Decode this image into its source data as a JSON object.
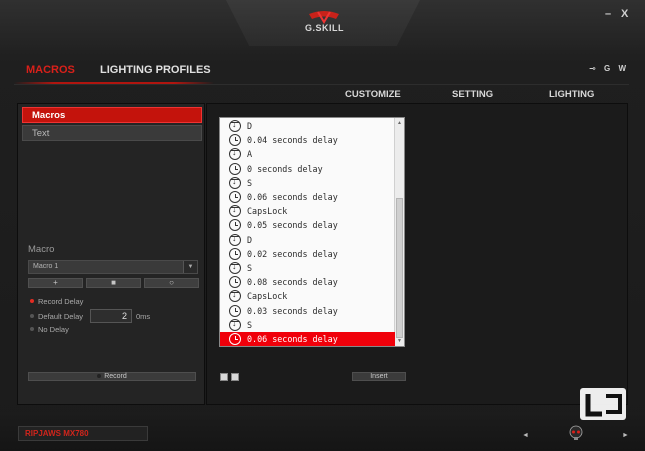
{
  "window": {
    "brand_text": "G.SKILL",
    "minimize_label": "–",
    "close_label": "X"
  },
  "nav": {
    "macros_label": "MACROS",
    "lighting_profiles_label": "LIGHTING PROFILES",
    "mini_icons": "⊸ G W"
  },
  "subtabs": [
    "CUSTOMIZE",
    "SETTING",
    "LIGHTING"
  ],
  "left": {
    "tabs": [
      {
        "label": "Macros",
        "active": true
      },
      {
        "label": "Text",
        "active": false
      }
    ],
    "macro_label": "Macro",
    "macro_select_value": "Macro 1",
    "tool_buttons": [
      "+",
      "■",
      "○"
    ],
    "delay_options": [
      {
        "label": "Record Delay",
        "selected": true
      },
      {
        "label": "Default Delay",
        "selected": false
      },
      {
        "label": "No Delay",
        "selected": false
      }
    ],
    "default_delay_value": "2",
    "default_delay_unit": "0ms",
    "record_button": "Record"
  },
  "list": {
    "rows": [
      {
        "type": "key",
        "text": "D"
      },
      {
        "type": "time",
        "text": "0.04 seconds delay"
      },
      {
        "type": "key",
        "text": "A"
      },
      {
        "type": "time",
        "text": "0 seconds delay"
      },
      {
        "type": "key",
        "text": "S"
      },
      {
        "type": "time",
        "text": "0.06 seconds delay"
      },
      {
        "type": "key",
        "text": "CapsLock"
      },
      {
        "type": "time",
        "text": "0.05 seconds delay"
      },
      {
        "type": "key",
        "text": "D"
      },
      {
        "type": "time",
        "text": "0.02 seconds delay"
      },
      {
        "type": "key",
        "text": "S"
      },
      {
        "type": "time",
        "text": "0.08 seconds delay"
      },
      {
        "type": "key",
        "text": "CapsLock"
      },
      {
        "type": "time",
        "text": "0.03 seconds delay"
      },
      {
        "type": "key",
        "text": "S"
      },
      {
        "type": "time",
        "text": "0.06 seconds delay",
        "selected": true
      }
    ],
    "insert_button": "Insert"
  },
  "footer": {
    "device_name": "RIPJAWS MX780",
    "prev": "◄",
    "next": "►"
  },
  "colors": {
    "accent_red": "#d9201a",
    "selection_red": "#f0000a"
  }
}
